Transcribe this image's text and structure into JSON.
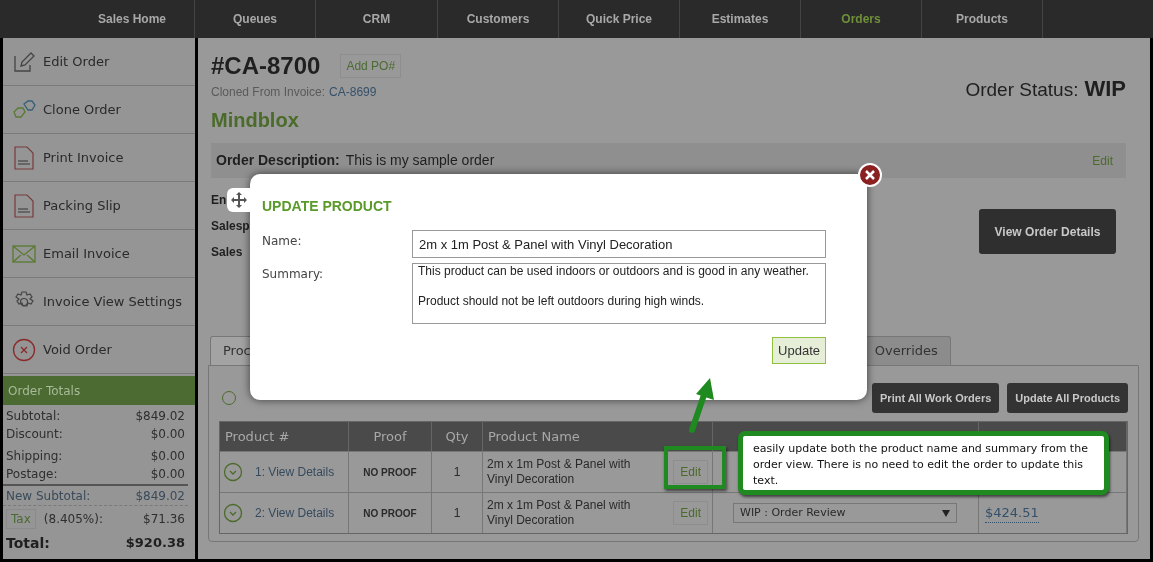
{
  "nav": [
    {
      "label": "Sales Home",
      "selected": false
    },
    {
      "label": "Queues",
      "selected": false
    },
    {
      "label": "CRM",
      "selected": false
    },
    {
      "label": "Customers",
      "selected": false
    },
    {
      "label": "Quick Price",
      "selected": false
    },
    {
      "label": "Estimates",
      "selected": false
    },
    {
      "label": "Orders",
      "selected": true
    },
    {
      "label": "Products",
      "selected": false
    }
  ],
  "sidebar": {
    "actions": [
      {
        "label": "Edit Order",
        "kind": "edit"
      },
      {
        "label": "Clone Order",
        "kind": "clone"
      },
      {
        "label": "Print Invoice",
        "kind": "pdf"
      },
      {
        "label": "Packing Slip",
        "kind": "pdf"
      },
      {
        "label": "Email Invoice",
        "kind": "email"
      },
      {
        "label": "Invoice View Settings",
        "kind": "settings"
      },
      {
        "label": "Void Order",
        "kind": "void"
      }
    ],
    "totals": {
      "title": "Order Totals",
      "lines": [
        {
          "label": "Subtotal:",
          "value": "$849.02"
        },
        {
          "label": "Discount:",
          "value": "$0.00"
        },
        {
          "label": "Shipping:",
          "value": "$0.00"
        },
        {
          "label": "Postage:",
          "value": "$0.00"
        }
      ],
      "new_subtotal": {
        "label": "New Subtotal:",
        "value": "$849.02"
      },
      "tax": {
        "button": "Tax",
        "rate": "(8.405%):",
        "value": "$71.36"
      },
      "total": {
        "label": "Total:",
        "value": "$920.38"
      }
    }
  },
  "order": {
    "number": "#CA-8700",
    "add_po": "Add PO#",
    "cloned_label": "Cloned From Invoice:",
    "cloned_invoice": "CA-8699",
    "customer": "Mindblox",
    "status_label": "Order Status:",
    "status": "WIP",
    "description_label": "Order Description:",
    "description": "This is my sample order",
    "edit": "Edit",
    "fields": [
      "En",
      "Salesp",
      "Sales"
    ],
    "view_details": "View Order Details"
  },
  "tabs": [
    {
      "label": "Proc",
      "selected": true
    },
    {
      "label": "Overrides",
      "selected": false
    }
  ],
  "toolbar": {
    "buttons": [
      "Print All Work Orders",
      "Update All Products"
    ]
  },
  "table": {
    "columns": [
      "Product #",
      "Proof",
      "Qty",
      "Product Name"
    ],
    "rows": [
      {
        "product": "1: View Details",
        "proof": "NO PROOF",
        "qty": "1",
        "name": "2m x 1m Post & Panel with Vinyl Decoration",
        "edit": "Edit"
      },
      {
        "product": "2: View Details",
        "proof": "NO PROOF",
        "qty": "1",
        "name": "2m x 1m Post & Panel with Vinyl Decoration",
        "edit": "Edit",
        "status": "WIP : Order Review",
        "price": "$424.51"
      }
    ]
  },
  "modal": {
    "title": "UPDATE PRODUCT",
    "name_label": "Name:",
    "name": "2m x 1m Post & Panel with Vinyl Decoration",
    "summary_label": "Summary:",
    "summary": "This product can be used indoors or outdoors and is good in any weather.\n\nProduct should not be left outdoors during high winds.",
    "button": "Update"
  },
  "callout": {
    "text": "easily update both the product name and summary from the order view. There is no need to edit the order to update this text."
  }
}
